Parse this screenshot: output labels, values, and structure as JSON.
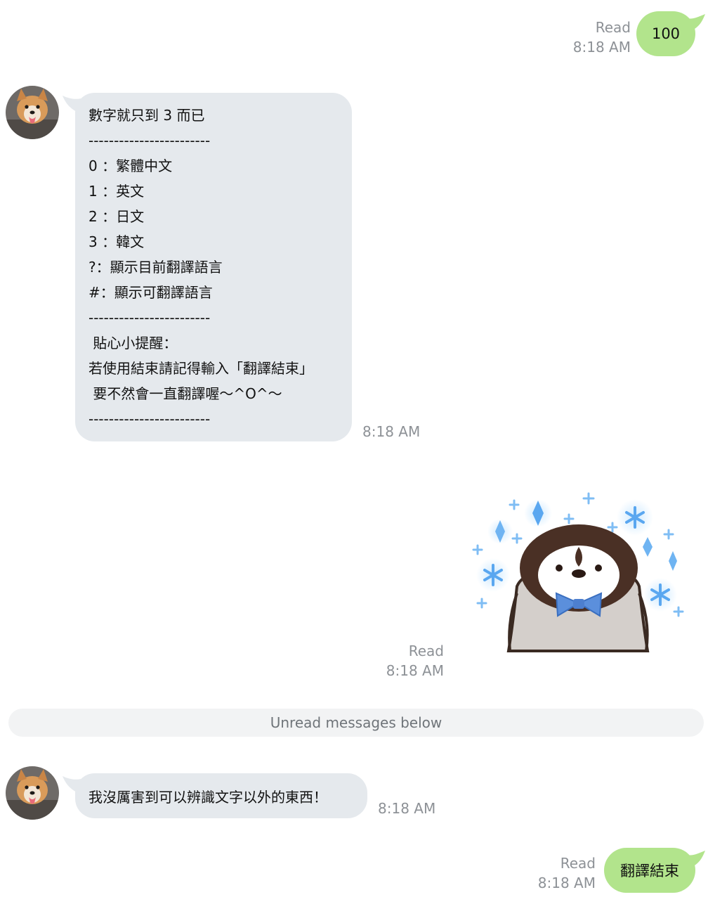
{
  "messages": {
    "sent_1": {
      "text": "100",
      "status": "Read",
      "time": "8:18 AM"
    },
    "received_1": {
      "lines": [
        "數字就只到 3 而已",
        "------------------------",
        "0 ：繁體中文",
        "1 ：英文",
        "2 ：日文",
        "3 ：韓文",
        "?：顯示目前翻譯語言",
        "#：顯示可翻譯語言",
        "------------------------",
        " 貼心小提醒：",
        "若使用結束請記得輸入「翻譯結束」",
        " 要不然會一直翻譯喔～^O^～",
        "------------------------"
      ],
      "time": "8:18 AM"
    },
    "sticker": {
      "icon": "penguin-bowtie-sticker-icon",
      "status": "Read",
      "time": "8:18 AM"
    },
    "divider": {
      "text": "Unread messages below"
    },
    "received_2": {
      "text": "我沒厲害到可以辨識文字以外的東西！",
      "time": "8:18 AM"
    },
    "sent_2": {
      "text": "翻譯結束",
      "status": "Read",
      "time": "8:18 AM"
    }
  },
  "colors": {
    "sent_bubble": "#b2e48c",
    "received_bubble": "#e5e9ed",
    "meta_text": "#8d9196",
    "background": "#ffffff"
  }
}
